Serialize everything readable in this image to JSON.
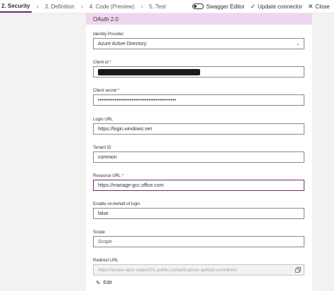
{
  "steps": [
    {
      "label": "2. Security",
      "active": true
    },
    {
      "label": "3. Definition",
      "active": false
    },
    {
      "label": "4. Code (Preview)",
      "active": false
    },
    {
      "label": "5. Test",
      "active": false
    }
  ],
  "top_actions": {
    "swagger_editor": "Swagger Editor",
    "update_connector": "Update connector",
    "close": "Close"
  },
  "panel": {
    "header": "OAuth 2.0",
    "identity_provider": {
      "label": "Identity Provider",
      "value": "Azure Active Directory"
    },
    "client_id": {
      "label": "Client id",
      "required_mark": "*"
    },
    "client_secret": {
      "label": "Client secret",
      "required_mark": "*",
      "value": "••••••••••••••••••••••••••••••••••••••••••"
    },
    "login_url": {
      "label": "Login URL",
      "value": "https://login.windows.net"
    },
    "tenant_id": {
      "label": "Tenant ID",
      "value": "common"
    },
    "resource_url": {
      "label": "Resource URL",
      "required_mark": "*",
      "value": "https://manage-gcc.office.com"
    },
    "obo": {
      "label": "Enable on-behalf-of login",
      "value": "false"
    },
    "scope": {
      "label": "Scope",
      "placeholder": "Scope"
    },
    "redirect_url": {
      "label": "Redirect URL",
      "value": "https://power-apis-usgov001-public.consent.azure-apihub.us/redirect"
    },
    "edit_label": "Edit"
  },
  "colors": {
    "accent": "#742774",
    "header_bg": "#efd6ef"
  }
}
